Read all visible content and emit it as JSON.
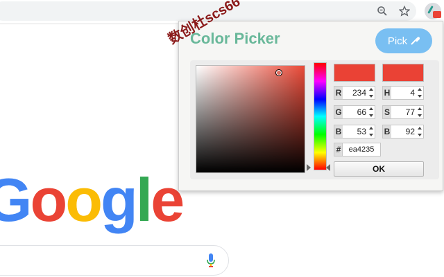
{
  "browser": {
    "zoom_icon": "zoom-icon",
    "star_icon": "bookmark-star-icon",
    "extension_icon": "color-picker-extension-icon"
  },
  "page": {
    "logo_letters": [
      "G",
      "o",
      "o",
      "g",
      "l",
      "e"
    ],
    "mic_icon": "mic-icon"
  },
  "popup": {
    "title": "Color Picker",
    "pick_label": "Pick",
    "pick_icon": "eyedropper-icon",
    "colors": {
      "selected": "#ea4235",
      "title": "#69b89a",
      "pick_bg": "#79bff2"
    },
    "rgb": [
      {
        "label": "R",
        "value": "234"
      },
      {
        "label": "G",
        "value": "66"
      },
      {
        "label": "B",
        "value": "53"
      }
    ],
    "hsb": [
      {
        "label": "H",
        "value": "4"
      },
      {
        "label": "S",
        "value": "77"
      },
      {
        "label": "B",
        "value": "92"
      }
    ],
    "hex_label": "#",
    "hex_value": "ea4235",
    "ok_label": "OK"
  },
  "watermark": "数创杜scs66"
}
